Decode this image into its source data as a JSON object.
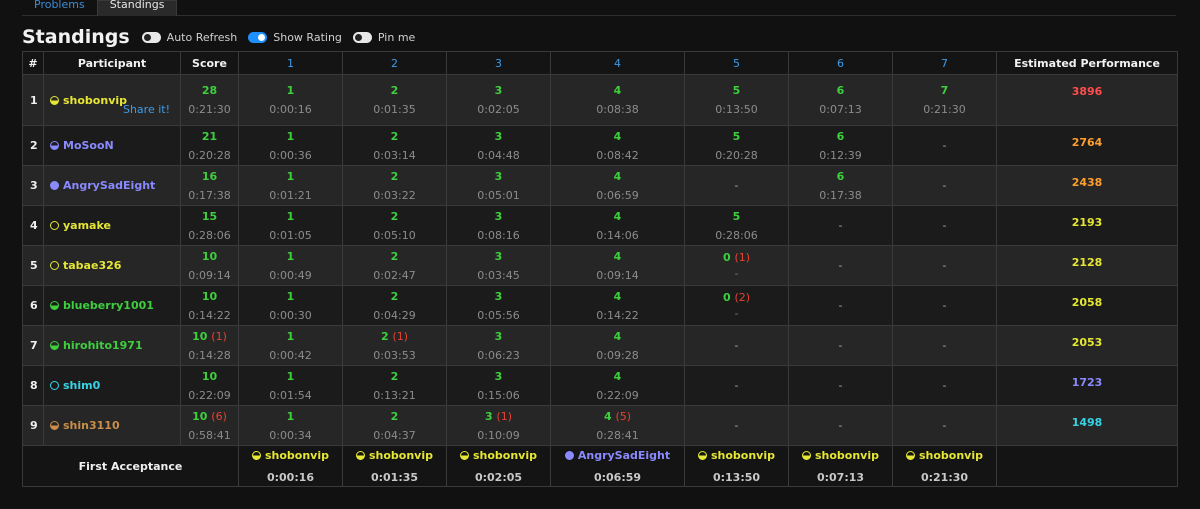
{
  "tabs": [
    {
      "label": "Problems"
    },
    {
      "label": "Standings"
    }
  ],
  "page_title": "Standings",
  "toggles": [
    {
      "label": "Auto Refresh",
      "on": false
    },
    {
      "label": "Show Rating",
      "on": true
    },
    {
      "label": "Pin me",
      "on": false
    }
  ],
  "columns": {
    "rank": "#",
    "participant": "Participant",
    "score": "Score",
    "tasks": [
      "1",
      "2",
      "3",
      "4",
      "5",
      "6",
      "7"
    ],
    "perf": "Estimated Performance"
  },
  "share_label": "Share it!",
  "rows": [
    {
      "rank": "1",
      "name": "shobonvip",
      "color": "#e6e635",
      "fill": "half",
      "score": "28",
      "score_pen": "",
      "score_time": "0:21:30",
      "tasks": [
        {
          "v": "1",
          "pen": "",
          "t": "0:00:16"
        },
        {
          "v": "2",
          "pen": "",
          "t": "0:01:35"
        },
        {
          "v": "3",
          "pen": "",
          "t": "0:02:05"
        },
        {
          "v": "4",
          "pen": "",
          "t": "0:08:38"
        },
        {
          "v": "5",
          "pen": "",
          "t": "0:13:50"
        },
        {
          "v": "6",
          "pen": "",
          "t": "0:07:13"
        },
        {
          "v": "7",
          "pen": "",
          "t": "0:21:30"
        }
      ],
      "perf": "3896",
      "perf_color": "#ff4d4d"
    },
    {
      "rank": "2",
      "name": "MoSooN",
      "color": "#8a8aff",
      "fill": "half",
      "score": "21",
      "score_pen": "",
      "score_time": "0:20:28",
      "tasks": [
        {
          "v": "1",
          "pen": "",
          "t": "0:00:36"
        },
        {
          "v": "2",
          "pen": "",
          "t": "0:03:14"
        },
        {
          "v": "3",
          "pen": "",
          "t": "0:04:48"
        },
        {
          "v": "4",
          "pen": "",
          "t": "0:08:42"
        },
        {
          "v": "5",
          "pen": "",
          "t": "0:20:28"
        },
        {
          "v": "6",
          "pen": "",
          "t": "0:12:39"
        },
        {
          "v": "-",
          "pen": "",
          "t": ""
        }
      ],
      "perf": "2764",
      "perf_color": "#ff9f2e"
    },
    {
      "rank": "3",
      "name": "AngrySadEight",
      "color": "#8a8aff",
      "fill": "full",
      "score": "16",
      "score_pen": "",
      "score_time": "0:17:38",
      "tasks": [
        {
          "v": "1",
          "pen": "",
          "t": "0:01:21"
        },
        {
          "v": "2",
          "pen": "",
          "t": "0:03:22"
        },
        {
          "v": "3",
          "pen": "",
          "t": "0:05:01"
        },
        {
          "v": "4",
          "pen": "",
          "t": "0:06:59"
        },
        {
          "v": "-",
          "pen": "",
          "t": ""
        },
        {
          "v": "6",
          "pen": "",
          "t": "0:17:38"
        },
        {
          "v": "-",
          "pen": "",
          "t": ""
        }
      ],
      "perf": "2438",
      "perf_color": "#ff9f2e"
    },
    {
      "rank": "4",
      "name": "yamake",
      "color": "#e6e635",
      "fill": "empty",
      "score": "15",
      "score_pen": "",
      "score_time": "0:28:06",
      "tasks": [
        {
          "v": "1",
          "pen": "",
          "t": "0:01:05"
        },
        {
          "v": "2",
          "pen": "",
          "t": "0:05:10"
        },
        {
          "v": "3",
          "pen": "",
          "t": "0:08:16"
        },
        {
          "v": "4",
          "pen": "",
          "t": "0:14:06"
        },
        {
          "v": "5",
          "pen": "",
          "t": "0:28:06"
        },
        {
          "v": "-",
          "pen": "",
          "t": ""
        },
        {
          "v": "-",
          "pen": "",
          "t": ""
        }
      ],
      "perf": "2193",
      "perf_color": "#e6e635"
    },
    {
      "rank": "5",
      "name": "tabae326",
      "color": "#e6e635",
      "fill": "empty",
      "score": "10",
      "score_pen": "",
      "score_time": "0:09:14",
      "tasks": [
        {
          "v": "1",
          "pen": "",
          "t": "0:00:49"
        },
        {
          "v": "2",
          "pen": "",
          "t": "0:02:47"
        },
        {
          "v": "3",
          "pen": "",
          "t": "0:03:45"
        },
        {
          "v": "4",
          "pen": "",
          "t": "0:09:14"
        },
        {
          "v": "0",
          "pen": "(1)",
          "t": "-"
        },
        {
          "v": "-",
          "pen": "",
          "t": ""
        },
        {
          "v": "-",
          "pen": "",
          "t": ""
        }
      ],
      "perf": "2128",
      "perf_color": "#e6e635"
    },
    {
      "rank": "6",
      "name": "blueberry1001",
      "color": "#3ecf3e",
      "fill": "half",
      "score": "10",
      "score_pen": "",
      "score_time": "0:14:22",
      "tasks": [
        {
          "v": "1",
          "pen": "",
          "t": "0:00:30"
        },
        {
          "v": "2",
          "pen": "",
          "t": "0:04:29"
        },
        {
          "v": "3",
          "pen": "",
          "t": "0:05:56"
        },
        {
          "v": "4",
          "pen": "",
          "t": "0:14:22"
        },
        {
          "v": "0",
          "pen": "(2)",
          "t": "-"
        },
        {
          "v": "-",
          "pen": "",
          "t": ""
        },
        {
          "v": "-",
          "pen": "",
          "t": ""
        }
      ],
      "perf": "2058",
      "perf_color": "#e6e635"
    },
    {
      "rank": "7",
      "name": "hirohito1971",
      "color": "#3ecf3e",
      "fill": "half",
      "score": "10",
      "score_pen": "(1)",
      "score_time": "0:14:28",
      "tasks": [
        {
          "v": "1",
          "pen": "",
          "t": "0:00:42"
        },
        {
          "v": "2",
          "pen": "(1)",
          "t": "0:03:53"
        },
        {
          "v": "3",
          "pen": "",
          "t": "0:06:23"
        },
        {
          "v": "4",
          "pen": "",
          "t": "0:09:28"
        },
        {
          "v": "-",
          "pen": "",
          "t": ""
        },
        {
          "v": "-",
          "pen": "",
          "t": ""
        },
        {
          "v": "-",
          "pen": "",
          "t": ""
        }
      ],
      "perf": "2053",
      "perf_color": "#e6e635"
    },
    {
      "rank": "8",
      "name": "shim0",
      "color": "#35d4e6",
      "fill": "empty",
      "score": "10",
      "score_pen": "",
      "score_time": "0:22:09",
      "tasks": [
        {
          "v": "1",
          "pen": "",
          "t": "0:01:54"
        },
        {
          "v": "2",
          "pen": "",
          "t": "0:13:21"
        },
        {
          "v": "3",
          "pen": "",
          "t": "0:15:06"
        },
        {
          "v": "4",
          "pen": "",
          "t": "0:22:09"
        },
        {
          "v": "-",
          "pen": "",
          "t": ""
        },
        {
          "v": "-",
          "pen": "",
          "t": ""
        },
        {
          "v": "-",
          "pen": "",
          "t": ""
        }
      ],
      "perf": "1723",
      "perf_color": "#8a8aff"
    },
    {
      "rank": "9",
      "name": "shin3110",
      "color": "#c98e4a",
      "fill": "half",
      "score": "10",
      "score_pen": "(6)",
      "score_time": "0:58:41",
      "tasks": [
        {
          "v": "1",
          "pen": "",
          "t": "0:00:34"
        },
        {
          "v": "2",
          "pen": "",
          "t": "0:04:37"
        },
        {
          "v": "3",
          "pen": "(1)",
          "t": "0:10:09"
        },
        {
          "v": "4",
          "pen": "(5)",
          "t": "0:28:41"
        },
        {
          "v": "-",
          "pen": "",
          "t": ""
        },
        {
          "v": "-",
          "pen": "",
          "t": ""
        },
        {
          "v": "-",
          "pen": "",
          "t": ""
        }
      ],
      "perf": "1498",
      "perf_color": "#35d4e6"
    }
  ],
  "first_acceptance": {
    "label": "First Acceptance",
    "entries": [
      {
        "name": "shobonvip",
        "color": "#e6e635",
        "fill": "half",
        "time": "0:00:16"
      },
      {
        "name": "shobonvip",
        "color": "#e6e635",
        "fill": "half",
        "time": "0:01:35"
      },
      {
        "name": "shobonvip",
        "color": "#e6e635",
        "fill": "half",
        "time": "0:02:05"
      },
      {
        "name": "AngrySadEight",
        "color": "#8a8aff",
        "fill": "full",
        "time": "0:06:59"
      },
      {
        "name": "shobonvip",
        "color": "#e6e635",
        "fill": "half",
        "time": "0:13:50"
      },
      {
        "name": "shobonvip",
        "color": "#e6e635",
        "fill": "half",
        "time": "0:07:13"
      },
      {
        "name": "shobonvip",
        "color": "#e6e635",
        "fill": "half",
        "time": "0:21:30"
      }
    ]
  }
}
